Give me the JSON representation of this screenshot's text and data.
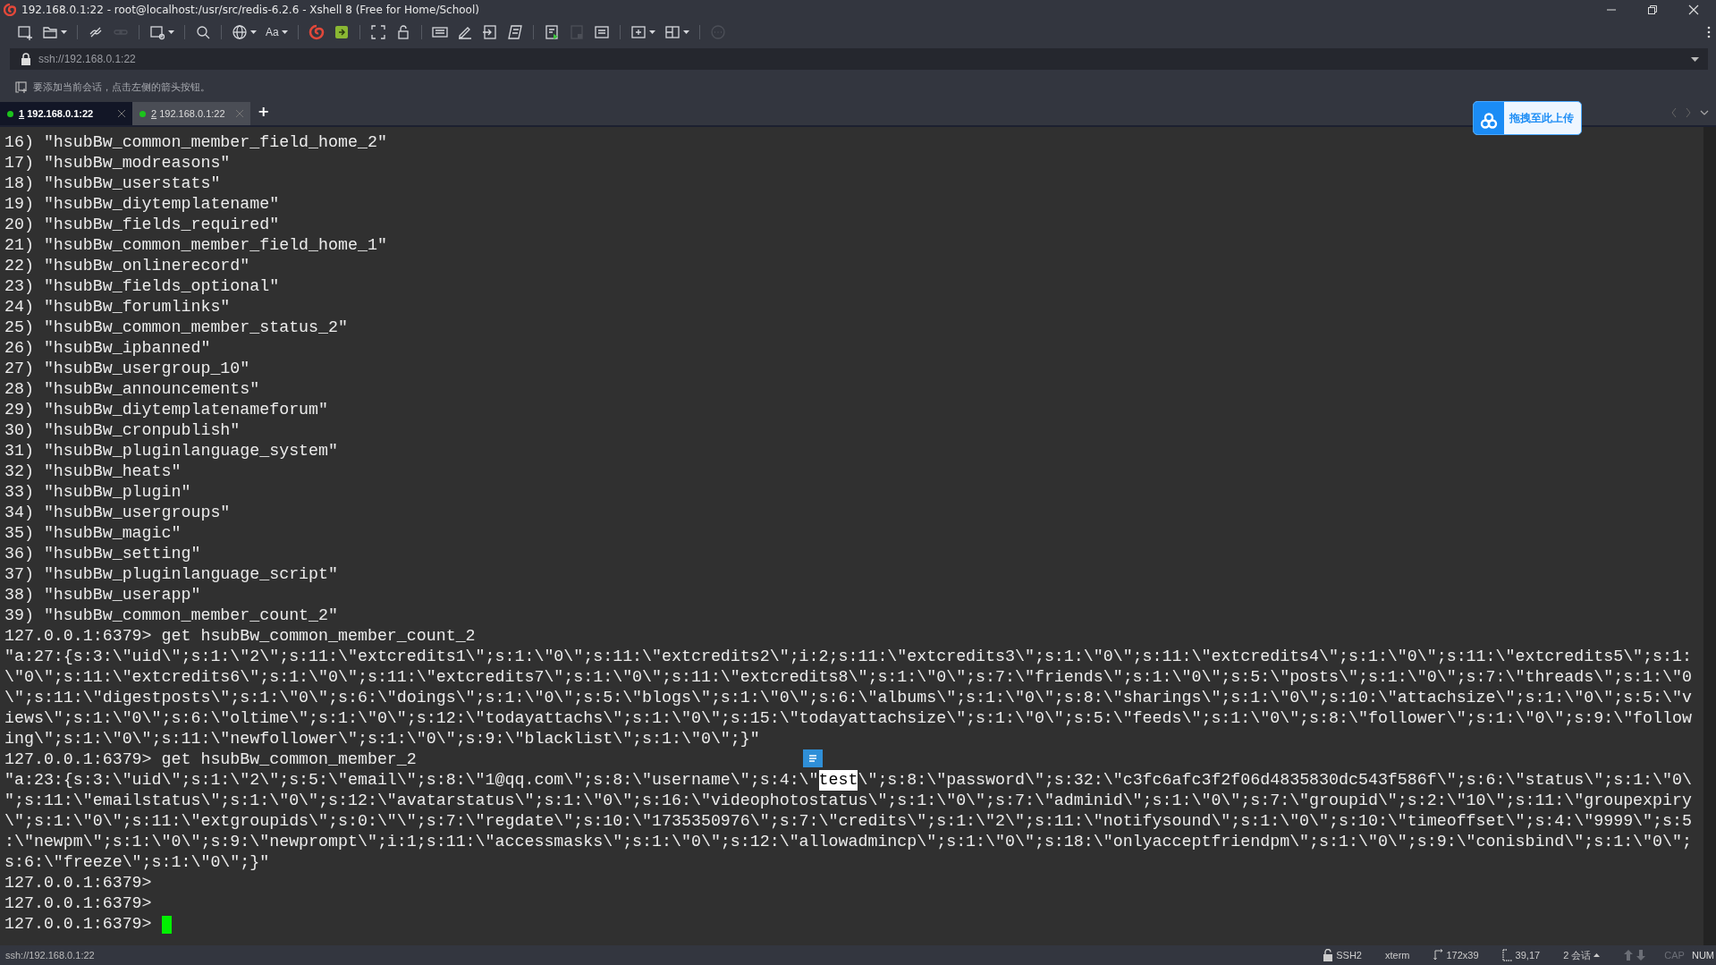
{
  "window": {
    "title": "192.168.0.1:22 - root@localhost:/usr/src/redis-6.2.6 - Xshell 8 (Free for Home/School)"
  },
  "toolbar": [
    [
      {
        "dropdown": false,
        "disabled": false
      },
      {
        "dropdown": true,
        "disabled": false
      }
    ],
    [
      {
        "dropdown": false,
        "disabled": false
      },
      {
        "dropdown": false,
        "disabled": true
      }
    ],
    [
      {
        "dropdown": true,
        "disabled": false
      }
    ],
    [
      {
        "dropdown": false,
        "disabled": false
      }
    ],
    [
      {
        "dropdown": true,
        "disabled": false
      },
      {
        "dropdown": true,
        "disabled": false,
        "label": "Aa"
      }
    ],
    [
      {
        "dropdown": false,
        "disabled": false
      },
      {
        "dropdown": false,
        "disabled": false
      }
    ],
    [
      {
        "dropdown": false,
        "disabled": false
      },
      {
        "dropdown": false,
        "disabled": false
      }
    ],
    [
      {
        "dropdown": false,
        "disabled": false
      },
      {
        "dropdown": false,
        "disabled": false
      },
      {
        "dropdown": false,
        "disabled": false
      },
      {
        "dropdown": false,
        "disabled": false
      }
    ],
    [
      {
        "dropdown": false,
        "disabled": false
      },
      {
        "dropdown": false,
        "disabled": true
      },
      {
        "dropdown": false,
        "disabled": false
      }
    ],
    [
      {
        "dropdown": true,
        "disabled": false
      },
      {
        "dropdown": true,
        "disabled": false
      }
    ],
    [
      {
        "dropdown": false,
        "disabled": true
      }
    ]
  ],
  "address_bar": {
    "value": "ssh://192.168.0.1:22"
  },
  "hint": "要添加当前会话，点击左侧的箭头按钮。",
  "tabs": [
    {
      "number": "1",
      "label": "192.168.0.1:22",
      "selected": true,
      "connected": true
    },
    {
      "number": "2",
      "label": "192.168.0.1:22",
      "selected": false,
      "connected": true
    }
  ],
  "new_tab": "+",
  "upload_button": "拖拽至此上传",
  "terminal": {
    "cursor_visible": true,
    "lines": [
      {
        "text": "16) \"hsubBw_common_member_field_home_2\""
      },
      {
        "text": "17) \"hsubBw_modreasons\""
      },
      {
        "text": "18) \"hsubBw_userstats\""
      },
      {
        "text": "19) \"hsubBw_diytemplatename\""
      },
      {
        "text": "20) \"hsubBw_fields_required\""
      },
      {
        "text": "21) \"hsubBw_common_member_field_home_1\""
      },
      {
        "text": "22) \"hsubBw_onlinerecord\""
      },
      {
        "text": "23) \"hsubBw_fields_optional\""
      },
      {
        "text": "24) \"hsubBw_forumlinks\""
      },
      {
        "text": "25) \"hsubBw_common_member_status_2\""
      },
      {
        "text": "26) \"hsubBw_ipbanned\""
      },
      {
        "text": "27) \"hsubBw_usergroup_10\""
      },
      {
        "text": "28) \"hsubBw_announcements\""
      },
      {
        "text": "29) \"hsubBw_diytemplatenameforum\""
      },
      {
        "text": "30) \"hsubBw_cronpublish\""
      },
      {
        "text": "31) \"hsubBw_pluginlanguage_system\""
      },
      {
        "text": "32) \"hsubBw_heats\""
      },
      {
        "text": "33) \"hsubBw_plugin\""
      },
      {
        "text": "34) \"hsubBw_usergroups\""
      },
      {
        "text": "35) \"hsubBw_magic\""
      },
      {
        "text": "36) \"hsubBw_setting\""
      },
      {
        "text": "37) \"hsubBw_pluginlanguage_script\""
      },
      {
        "text": "38) \"hsubBw_userapp\""
      },
      {
        "text": "39) \"hsubBw_common_member_count_2\""
      },
      {
        "text": "127.0.0.1:6379> get hsubBw_common_member_count_2"
      },
      {
        "text": "\"a:27:{s:3:\\\"uid\\\";s:1:\\\"2\\\";s:11:\\\"extcredits1\\\";s:1:\\\"0\\\";s:11:\\\"extcredits2\\\";i:2;s:11:\\\"extcredits3\\\";s:1:\\\"0\\\";s:11:\\\"extcredits4\\\";s:1:\\\"0\\\";s:11:\\\"extcredits5\\\";s:1:"
      },
      {
        "text": "\\\"0\\\";s:11:\\\"extcredits6\\\";s:1:\\\"0\\\";s:11:\\\"extcredits7\\\";s:1:\\\"0\\\";s:11:\\\"extcredits8\\\";s:1:\\\"0\\\";s:7:\\\"friends\\\";s:1:\\\"0\\\";s:5:\\\"posts\\\";s:1:\\\"0\\\";s:7:\\\"threads\\\";s:1:\\\"0"
      },
      {
        "text": "\\\";s:11:\\\"digestposts\\\";s:1:\\\"0\\\";s:6:\\\"doings\\\";s:1:\\\"0\\\";s:5:\\\"blogs\\\";s:1:\\\"0\\\";s:6:\\\"albums\\\";s:1:\\\"0\\\";s:8:\\\"sharings\\\";s:1:\\\"0\\\";s:10:\\\"attachsize\\\";s:1:\\\"0\\\";s:5:\\\"v"
      },
      {
        "text": "iews\\\";s:1:\\\"0\\\";s:6:\\\"oltime\\\";s:1:\\\"0\\\";s:12:\\\"todayattachs\\\";s:1:\\\"0\\\";s:15:\\\"todayattachsize\\\";s:1:\\\"0\\\";s:5:\\\"feeds\\\";s:1:\\\"0\\\";s:8:\\\"follower\\\";s:1:\\\"0\\\";s:9:\\\"follow"
      },
      {
        "text": "ing\\\";s:1:\\\"0\\\";s:11:\\\"newfollower\\\";s:1:\\\"0\\\";s:9:\\\"blacklist\\\";s:1:\\\"0\\\";}\""
      },
      {
        "text": "127.0.0.1:6379> get hsubBw_common_member_2"
      },
      {
        "segments": [
          {
            "text": "\"a:23:{s:3:\\\"uid\\\";s:1:\\\"2\\\";s:5:\\\"email\\\";s:8:\\\"1@qq.com\\\";s:8:\\\"username\\\";s:4:\\\"",
            "selected": false
          },
          {
            "text": "test",
            "selected": true
          },
          {
            "text": "\\\";s:8:\\\"password\\\";s:32:\\\"c3fc6afc3f2f06d4835830dc543f586f\\\";s:6:\\\"status\\\";s:1:\\\"0\\",
            "selected": false
          }
        ]
      },
      {
        "text": "\";s:11:\\\"emailstatus\\\";s:1:\\\"0\\\";s:12:\\\"avatarstatus\\\";s:1:\\\"0\\\";s:16:\\\"videophotostatus\\\";s:1:\\\"0\\\";s:7:\\\"adminid\\\";s:1:\\\"0\\\";s:7:\\\"groupid\\\";s:2:\\\"10\\\";s:11:\\\"groupexpiry"
      },
      {
        "text": "\\\";s:1:\\\"0\\\";s:11:\\\"extgroupids\\\";s:0:\\\"\\\";s:7:\\\"regdate\\\";s:10:\\\"1735350976\\\";s:7:\\\"credits\\\";s:1:\\\"2\\\";s:11:\\\"notifysound\\\";s:1:\\\"0\\\";s:10:\\\"timeoffset\\\";s:4:\\\"9999\\\";s:5"
      },
      {
        "text": ":\\\"newpm\\\";s:1:\\\"0\\\";s:9:\\\"newprompt\\\";i:1;s:11:\\\"accessmasks\\\";s:1:\\\"0\\\";s:12:\\\"allowadmincp\\\";s:1:\\\"0\\\";s:18:\\\"onlyacceptfriendpm\\\";s:1:\\\"0\\\";s:9:\\\"conisbind\\\";s:1:\\\"0\\\";"
      },
      {
        "text": "s:6:\\\"freeze\\\";s:1:\\\"0\\\";}\""
      },
      {
        "text": "127.0.0.1:6379>"
      },
      {
        "text": "127.0.0.1:6379>"
      },
      {
        "text": "127.0.0.1:6379> "
      }
    ]
  },
  "status_bar": {
    "address": "ssh://192.168.0.1:22",
    "items": [
      {
        "text": "SSH2"
      },
      {
        "text": "xterm"
      },
      {
        "text": "172x39"
      },
      {
        "text": "39,17"
      },
      {
        "text": "2 会话"
      }
    ],
    "indicators": [
      {
        "text": "CAP",
        "on": false
      },
      {
        "text": "NUM",
        "on": true
      }
    ]
  }
}
